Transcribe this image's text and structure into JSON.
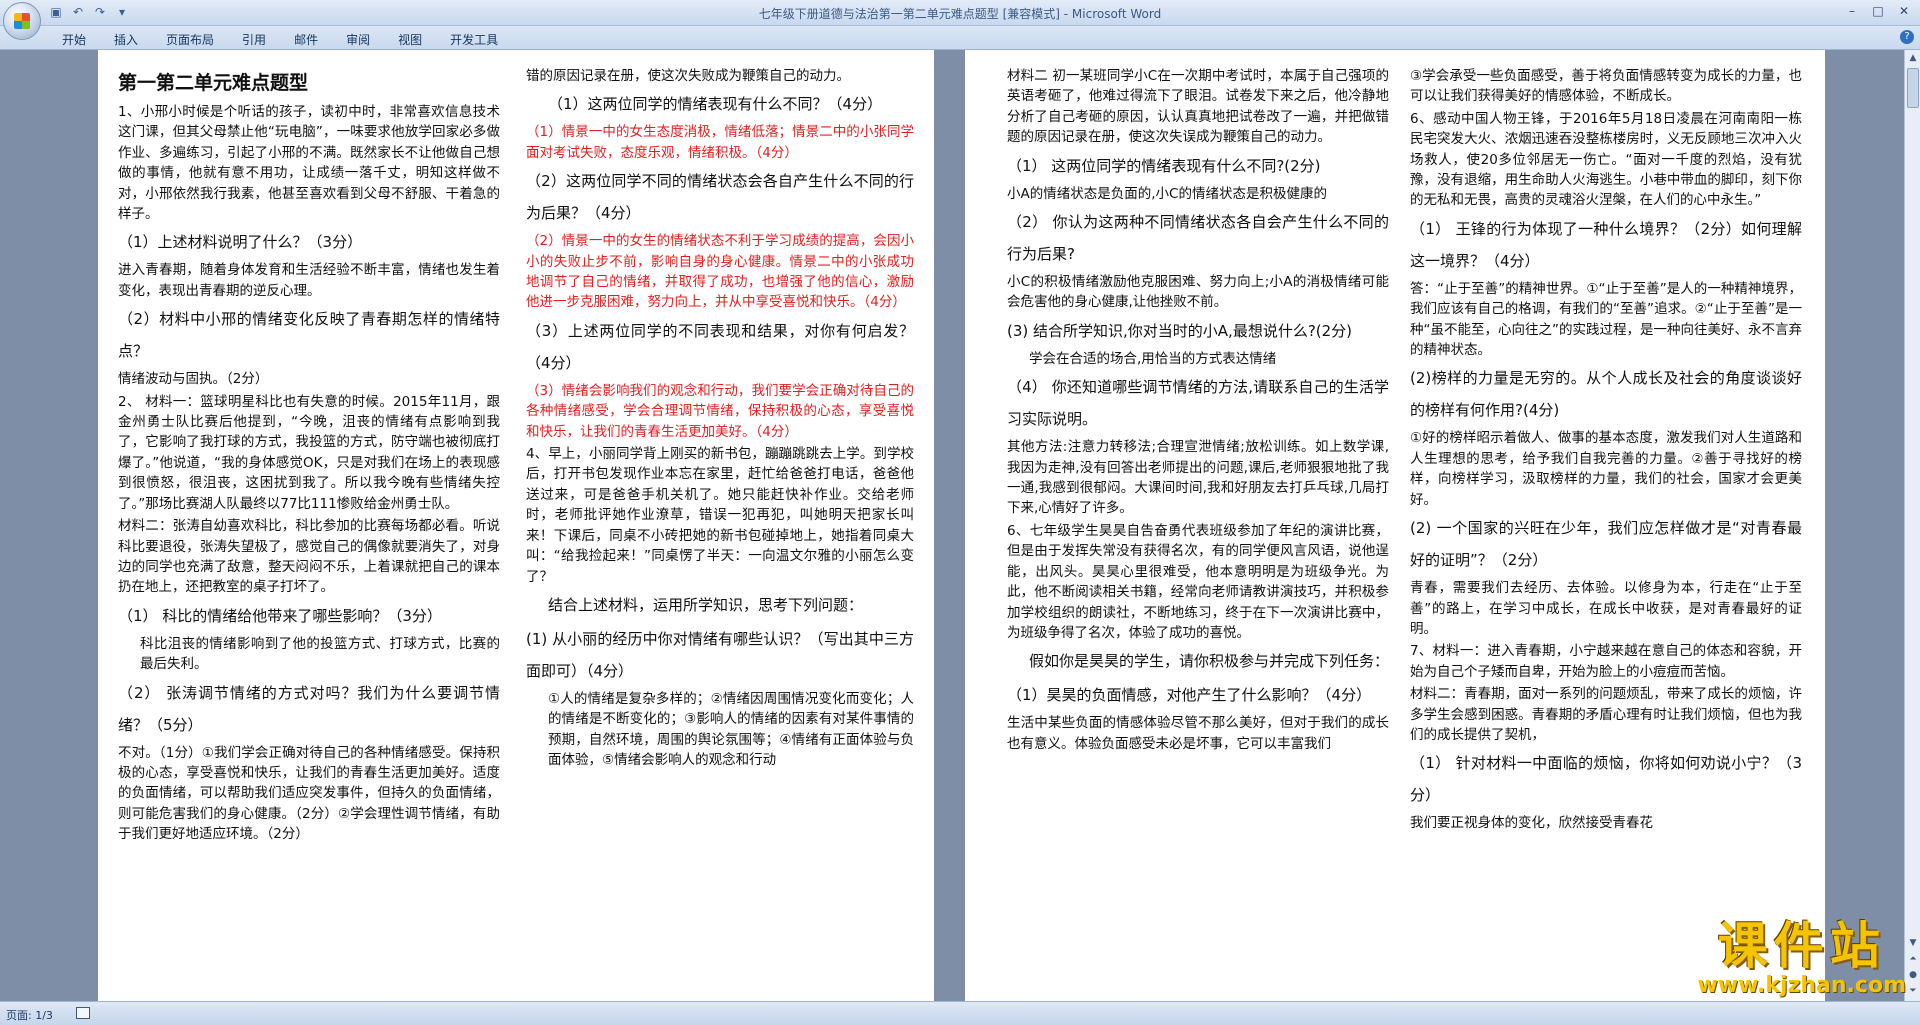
{
  "window": {
    "title": "七年级下册道德与法治第一第二单元难点题型 [兼容模式] - Microsoft Word"
  },
  "ribbon": {
    "tabs": [
      "开始",
      "插入",
      "页面布局",
      "引用",
      "邮件",
      "审阅",
      "视图",
      "开发工具"
    ]
  },
  "status": {
    "page": "页面: 1/3"
  },
  "watermark": {
    "text": "课件站",
    "url": "www.kjzhan.com"
  },
  "page1": {
    "col1": [
      {
        "t": "第一第二单元难点题型",
        "c": "h1"
      },
      {
        "t": "1、小邢小时候是个听话的孩子，读初中时，非常喜欢信息技术这门课，但其父母禁止他“玩电脑”，一味要求他放学回家必多做作业、多遍练习，引起了小邢的不满。既然家长不让他做自己想做的事情，他就有意不用功，让成绩一落千丈，明知这样做不对，小邢依然我行我素，他甚至喜欢看到父母不舒服、干着急的样子。",
        "c": "p"
      },
      {
        "t": "（1）上述材料说明了什么？（3分）",
        "c": "q"
      },
      {
        "t": "进入青春期，随着身体发育和生活经验不断丰富，情绪也发生着变化，表现出青春期的逆反心理。",
        "c": "p"
      },
      {
        "t": "（2）材料中小邢的情绪变化反映了青春期怎样的情绪特点？",
        "c": "q"
      },
      {
        "t": "情绪波动与固执。（2分）",
        "c": "p"
      },
      {
        "t": "2、 材料一：篮球明星科比也有失意的时候。2015年11月，跟金州勇士队比赛后他提到，“今晚，沮丧的情绪有点影响到我了，它影响了我打球的方式，我投篮的方式，防守端也被彻底打爆了。”他说道，“我的身体感觉OK，只是对我们在场上的表现感到很愤怒，很沮丧，这困扰到我了。所以我今晚有些情绪失控了。”那场比赛湖人队最终以77比111惨败给金州勇士队。",
        "c": "p"
      },
      {
        "t": "材料二：张涛自幼喜欢科比，科比参加的比赛每场都必看。听说科比要退役，张涛失望极了，感觉自己的偶像就要消失了，对身边的同学也充满了敌意，整天闷闷不乐，上着课就把自己的课本扔在地上，还把教室的桌子打坏了。",
        "c": "p"
      },
      {
        "t": "（1） 科比的情绪给他带来了哪些影响？（3分）",
        "c": "q"
      },
      {
        "t": "科比沮丧的情绪影响到了他的投篮方式、打球方式，比赛的最后失利。",
        "c": "p ind"
      },
      {
        "t": "（2） 张涛调节情绪的方式对吗？我们为什么要调节情绪？（5分）",
        "c": "q"
      },
      {
        "t": "不对。（1分）①我们学会正确对待自己的各种情绪感受。保持积极的心态，享受喜悦和快乐，让我们的青春生活更加美好。适度的负面情绪，可以帮助我们适应突发事件，但持久的负面情绪，则可能危害我们的身心健康。（2分）②学会理性调节情绪，有助于我们更好地适应环境。（2分）",
        "c": "p"
      }
    ],
    "col2": [
      {
        "t": "错的原因记录在册，使这次失败成为鞭策自己的动力。",
        "c": "p"
      },
      {
        "t": "（1）这两位同学的情绪表现有什么不同？（4分）",
        "c": "qi"
      },
      {
        "t": "（1）情景一中的女生态度消极，情绪低落；情景二中的小张同学面对考试失败，态度乐观，情绪积极。（4分）",
        "c": "p red"
      },
      {
        "t": "（2）这两位同学不同的情绪状态会各自产生什么不同的行为后果？（4分）",
        "c": "q"
      },
      {
        "t": "（2）情景一中的女生的情绪状态不利于学习成绩的提高，会因小小的失败止步不前，影响自身的身心健康。情景二中的小张成功地调节了自己的情绪，并取得了成功，也增强了他的信心，激励他进一步克服困难，努力向上，并从中享受喜悦和快乐。（4分）",
        "c": "p red"
      },
      {
        "t": "（3）上述两位同学的不同表现和结果，对你有何启发？（4分）",
        "c": "q"
      },
      {
        "t": "（3）情绪会影响我们的观念和行动，我们要学会正确对待自己的各种情绪感受，学会合理调节情绪，保持积极的心态，享受喜悦和快乐，让我们的青春生活更加美好。（4分）",
        "c": "p red"
      },
      {
        "t": "4、早上，小丽同学背上刚买的新书包，蹦蹦跳跳去上学。到学校后，打开书包发现作业本忘在家里，赶忙给爸爸打电话，爸爸他送过来，可是爸爸手机关机了。她只能赶快补作业。交给老师时，老师批评她作业潦草，错误一犯再犯，叫她明天把家长叫来！下课后，同桌不小砖把她的新书包碰掉地上，她指着同桌大叫：“给我捡起来！”同桌愣了半天：一向温文尔雅的小丽怎么变了？",
        "c": "p"
      },
      {
        "t": "结合上述材料，运用所学知识，思考下列问题：",
        "c": "qi"
      },
      {
        "t": "(1) 从小丽的经历中你对情绪有哪些认识？（写出其中三方面即可）（4分）",
        "c": "q"
      },
      {
        "t": "①人的情绪是复杂多样的；②情绪因周围情况变化而变化；人的情绪是不断变化的；③影响人的情绪的因素有对某件事情的预期，自然环境，周围的舆论氛围等；④情绪有正面体验与负面体验，⑤情绪会影响人的观念和行动",
        "c": "p ind"
      }
    ]
  },
  "page2": {
    "col1": [
      {
        "t": "材料二 初一某班同学小C在一次期中考试时，本属于自己强项的英语考砸了，他难过得流下了眼泪。试卷发下来之后，他冷静地分析了自己考砸的原因，认认真真地把试卷改了一遍，并把做错题的原因记录在册，使这次失误成为鞭策自己的动力。",
        "c": "p"
      },
      {
        "t": "（1） 这两位同学的情绪表现有什么不同?(2分)",
        "c": "q"
      },
      {
        "t": "小A的情绪状态是负面的,小C的情绪状态是积极健康的",
        "c": "p"
      },
      {
        "t": "（2） 你认为这两种不同情绪状态各自会产生什么不同的行为后果?",
        "c": "q"
      },
      {
        "t": "小C的积极情绪激励他克服困难、努力向上;小A的消极情绪可能会危害他的身心健康,让他挫败不前。",
        "c": "p"
      },
      {
        "t": "(3) 结合所学知识,你对当时的小A,最想说什么?(2分)",
        "c": "q"
      },
      {
        "t": "学会在合适的场合,用恰当的方式表达情绪",
        "c": "p ind"
      },
      {
        "t": "（4） 你还知道哪些调节情绪的方法,请联系自己的生活学习实际说明。",
        "c": "q"
      },
      {
        "t": "其他方法:注意力转移法;合理宣泄情绪;放松训练。如上数学课,我因为走神,没有回答出老师提出的问题,课后,老师狠狠地批了我一通,我感到很郁闷。大课间时间,我和好朋友去打乒乓球,几局打下来,心情好了许多。",
        "c": "p"
      },
      {
        "t": "6、七年级学生昊昊自告奋勇代表班级参加了年纪的演讲比赛，但是由于发挥失常没有获得名次，有的同学便风言风语，说他逞能，出风头。昊昊心里很难受，他本意明明是为班级争光。为此，他不断阅读相关书籍，经常向老师请教讲演技巧，并积极参加学校组织的朗读社，不断地练习，终于在下一次演讲比赛中，为班级争得了名次，体验了成功的喜悦。",
        "c": "p"
      },
      {
        "t": "假如你是昊昊的学生，请你积极参与并完成下列任务：",
        "c": "qi"
      },
      {
        "t": "（1）昊昊的负面情感，对他产生了什么影响？（4分）",
        "c": "q"
      },
      {
        "t": "生活中某些负面的情感体验尽管不那么美好，但对于我们的成长也有意义。体验负面感受未必是坏事，它可以丰富我们",
        "c": "p"
      }
    ],
    "col2": [
      {
        "t": "③学会承受一些负面感受，善于将负面情感转变为成长的力量，也可以让我们获得美好的情感体验，不断成长。",
        "c": "p"
      },
      {
        "t": "6、感动中国人物王锋，于2016年5月18日凌晨在河南南阳一栋民宅突发大火、浓烟迅速吞没整栋楼房时，义无反顾地三次冲入火场救人，使20多位邻居无一伤亡。“面对一千度的烈焰，没有犹豫，没有退缩，用生命助人火海逃生。小巷中带血的脚印，刻下你的无私和无畏，高贵的灵魂浴火涅槃，在人们的心中永生。”",
        "c": "p"
      },
      {
        "t": "（1） 王锋的行为体现了一种什么境界？（2分）如何理解这一境界？（4分）",
        "c": "q"
      },
      {
        "t": "答：“止于至善”的精神世界。①“止于至善”是人的一种精神境界，我们应该有自己的格调，有我们的“至善”追求。②“止于至善”是一种“虽不能至，心向往之”的实践过程，是一种向往美好、永不言弃的精神状态。",
        "c": "p"
      },
      {
        "t": "(2)榜样的力量是无穷的。从个人成长及社会的角度谈谈好的榜样有何作用?(4分)",
        "c": "q"
      },
      {
        "t": "①好的榜样昭示着做人、做事的基本态度，激发我们对人生道路和人生理想的思考，给予我们自我完善的力量。②善于寻找好的榜样，向榜样学习，汲取榜样的力量，我们的社会，国家才会更美好。",
        "c": "p"
      },
      {
        "t": "(2) 一个国家的兴旺在少年，我们应怎样做才是“对青春最好的证明”？（2分）",
        "c": "q"
      },
      {
        "t": "青春，需要我们去经历、去体验。以修身为本，行走在“止于至善”的路上，在学习中成长，在成长中收获，是对青春最好的证明。",
        "c": "p"
      },
      {
        "t": "7、材料一：进入青春期，小宁越来越在意自己的体态和容貌，开始为自己个子矮而自卑，开始为脸上的小痘痘而苦恼。",
        "c": "p"
      },
      {
        "t": "材料二：青春期，面对一系列的问题烦乱，带来了成长的烦恼，许多学生会感到困惑。青春期的矛盾心理有时让我们烦恼，但也为我们的成长提供了契机，",
        "c": "p"
      },
      {
        "t": "（1） 针对材料一中面临的烦恼，你将如何劝说小宁？（3分）",
        "c": "q"
      },
      {
        "t": "我们要正视身体的变化，欣然接受青春花",
        "c": "p"
      }
    ]
  }
}
